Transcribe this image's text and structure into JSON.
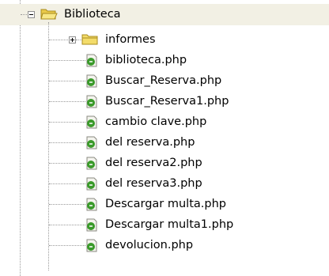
{
  "tree": {
    "root": {
      "label": "Biblioteca",
      "icon": "folder-open-icon",
      "expanded": true
    },
    "children": [
      {
        "label": "informes",
        "icon": "folder-icon",
        "type": "folder",
        "expanded": false
      },
      {
        "label": "biblioteca.php",
        "icon": "php-file-icon",
        "type": "file"
      },
      {
        "label": "Buscar_Reserva.php",
        "icon": "php-file-icon",
        "type": "file"
      },
      {
        "label": "Buscar_Reserva1.php",
        "icon": "php-file-icon",
        "type": "file"
      },
      {
        "label": "cambio clave.php",
        "icon": "php-file-icon",
        "type": "file"
      },
      {
        "label": "del reserva.php",
        "icon": "php-file-icon",
        "type": "file"
      },
      {
        "label": "del reserva2.php",
        "icon": "php-file-icon",
        "type": "file"
      },
      {
        "label": "del reserva3.php",
        "icon": "php-file-icon",
        "type": "file"
      },
      {
        "label": "Descargar multa.php",
        "icon": "php-file-icon",
        "type": "file"
      },
      {
        "label": "Descargar multa1.php",
        "icon": "php-file-icon",
        "type": "file"
      },
      {
        "label": "devolucion.php",
        "icon": "php-file-icon",
        "type": "file"
      }
    ]
  },
  "colors": {
    "selected_row_bg": "#f2f0e4",
    "folder_fill": "#f5e37a",
    "folder_outline": "#a88b1e",
    "php_icon_green": "#3a9a2a",
    "tree_line": "#9a9a9a"
  }
}
